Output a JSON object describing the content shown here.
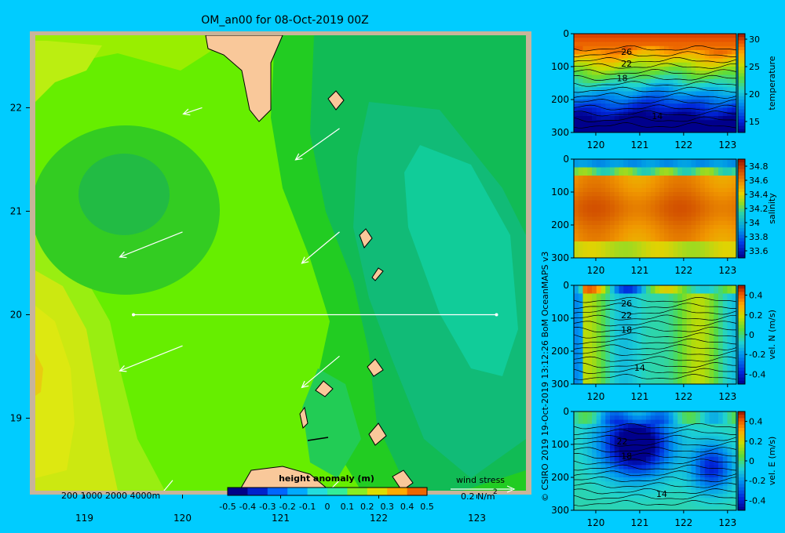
{
  "header": {
    "title": "OM_an00 for 08-Oct-2019 00Z"
  },
  "credit": "© CSIRO 2019  19-Oct-2019 13:12:26 BoM OceanMAPS v3",
  "depth_legend": "200  1000  2000  4000m",
  "wind_legend": {
    "title": "wind stress",
    "value": "0.2 N/m",
    "superscript": "2"
  },
  "colors": {
    "background": "#00ccff",
    "map_frame": "#c8b49a",
    "land": "#f9c89a",
    "transect": "#ffffff",
    "wind_arrow": "#ffffff"
  },
  "chart_data": [
    {
      "type": "heatmap",
      "name": "map",
      "title": "OM_an00 for 08-Oct-2019 00Z",
      "x_ticks": [
        119,
        120,
        121,
        122,
        123
      ],
      "y_ticks": [
        19,
        20,
        21,
        22
      ],
      "xlim": [
        118.5,
        123.5
      ],
      "ylim": [
        18.3,
        22.7
      ],
      "colorbar": {
        "label": "height anomaly (m)",
        "ticks": [
          "-0.5",
          "-0.4",
          "-0.3",
          "-0.2",
          "-0.1",
          "0",
          "0.1",
          "0.2",
          "0.3",
          "0.4",
          "0.5"
        ],
        "range": [
          -0.5,
          0.5
        ]
      },
      "regions": [
        {
          "value": 0.0,
          "center": [
            120.3,
            21.1
          ]
        },
        {
          "value": 0.02,
          "center": [
            119.4,
            21.0
          ]
        },
        {
          "value": 0.07,
          "center": [
            118.6,
            20.2
          ]
        },
        {
          "value": 0.1,
          "center": [
            118.5,
            19.6
          ]
        },
        {
          "value": -0.03,
          "center": [
            121.6,
            21.3
          ]
        },
        {
          "value": -0.06,
          "center": [
            122.3,
            21.0
          ]
        },
        {
          "value": -0.1,
          "center": [
            122.9,
            20.4
          ]
        },
        {
          "value": -0.03,
          "center": [
            122.5,
            19.0
          ]
        }
      ],
      "transect": {
        "lat": 20.0,
        "lon_start": 119.5,
        "lon_end": 123.2
      },
      "wind_arrows": [
        {
          "lon": 120.2,
          "lat": 22.0,
          "u": -0.03,
          "v": -0.01
        },
        {
          "lon": 121.6,
          "lat": 21.8,
          "u": -0.07,
          "v": -0.05
        },
        {
          "lon": 120.0,
          "lat": 20.8,
          "u": -0.1,
          "v": -0.04
        },
        {
          "lon": 121.6,
          "lat": 20.8,
          "u": -0.06,
          "v": -0.05
        },
        {
          "lon": 120.0,
          "lat": 19.7,
          "u": -0.1,
          "v": -0.04
        },
        {
          "lon": 121.6,
          "lat": 19.6,
          "u": -0.06,
          "v": -0.05
        },
        {
          "lon": 119.9,
          "lat": 18.4,
          "u": -0.05,
          "v": -0.06
        },
        {
          "lon": 121.6,
          "lat": 18.4,
          "u": -0.05,
          "v": -0.05
        }
      ]
    },
    {
      "type": "heatmap",
      "name": "temperature-section",
      "colorbar_label": "temperature",
      "x_ticks": [
        120,
        121,
        122,
        123
      ],
      "y_ticks": [
        0,
        100,
        200,
        300
      ],
      "xlim": [
        119.5,
        123.2
      ],
      "ylim": [
        300,
        0
      ],
      "color_range": [
        13,
        31
      ],
      "colorbar_ticks": [
        15,
        20,
        25,
        30
      ],
      "contour_labels": [
        {
          "text": "26",
          "x": 120.7,
          "y": 55
        },
        {
          "text": "22",
          "x": 120.7,
          "y": 90
        },
        {
          "text": "18",
          "x": 120.6,
          "y": 135
        },
        {
          "text": "14",
          "x": 121.4,
          "y": 250
        }
      ]
    },
    {
      "type": "heatmap",
      "name": "salinity-section",
      "colorbar_label": "salinity",
      "x_ticks": [
        120,
        121,
        122,
        123
      ],
      "y_ticks": [
        0,
        100,
        200,
        300
      ],
      "xlim": [
        119.5,
        123.2
      ],
      "ylim": [
        300,
        0
      ],
      "color_range": [
        33.5,
        34.9
      ],
      "colorbar_ticks": [
        "33.6",
        "33.8",
        "34",
        "34.2",
        "34.4",
        "34.6",
        "34.8"
      ]
    },
    {
      "type": "heatmap",
      "name": "velocity-north-section",
      "colorbar_label": "vel. N  (m/s)",
      "x_ticks": [
        120,
        121,
        122,
        123
      ],
      "y_ticks": [
        0,
        100,
        200,
        300
      ],
      "xlim": [
        119.5,
        123.2
      ],
      "ylim": [
        300,
        0
      ],
      "color_range": [
        -0.5,
        0.5
      ],
      "colorbar_ticks": [
        "-0.4",
        "-0.2",
        "0",
        "0.2",
        "0.4"
      ],
      "contour_labels": [
        {
          "text": "26",
          "x": 120.7,
          "y": 55
        },
        {
          "text": "22",
          "x": 120.7,
          "y": 90
        },
        {
          "text": "18",
          "x": 120.7,
          "y": 135
        },
        {
          "text": "14",
          "x": 121.0,
          "y": 250
        }
      ]
    },
    {
      "type": "heatmap",
      "name": "velocity-east-section",
      "colorbar_label": "vel. E  (m/s)",
      "x_ticks": [
        120,
        121,
        122,
        123
      ],
      "y_ticks": [
        0,
        100,
        200,
        300
      ],
      "xlim": [
        119.5,
        123.2
      ],
      "ylim": [
        300,
        0
      ],
      "color_range": [
        -0.5,
        0.5
      ],
      "colorbar_ticks": [
        "-0.4",
        "-0.2",
        "0",
        "0.2",
        "0.4"
      ],
      "contour_labels": [
        {
          "text": "22",
          "x": 120.6,
          "y": 90
        },
        {
          "text": "18",
          "x": 120.7,
          "y": 135
        },
        {
          "text": "14",
          "x": 121.5,
          "y": 250
        }
      ]
    }
  ]
}
